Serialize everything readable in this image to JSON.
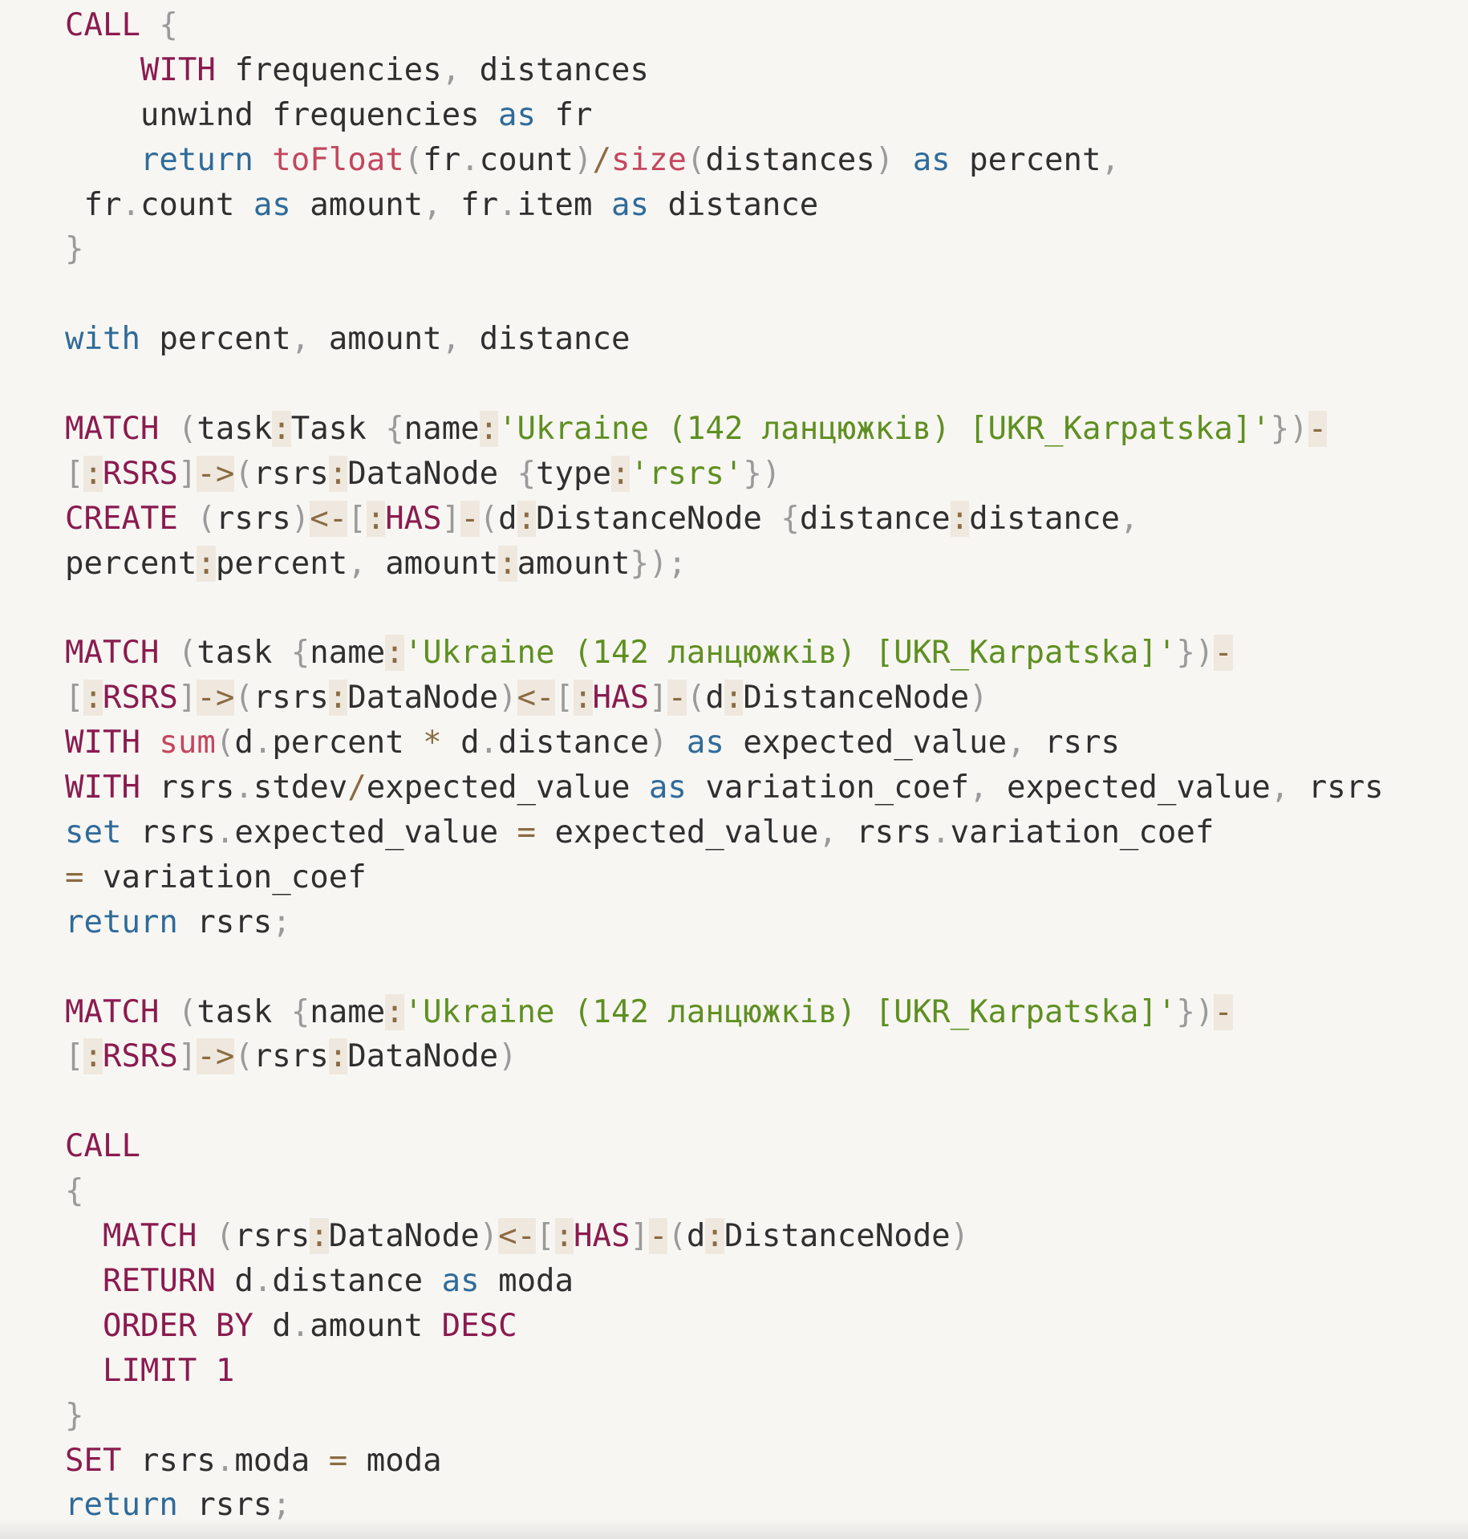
{
  "code_lines": [
    [
      {
        "text": "CALL",
        "type": "kw"
      },
      {
        "text": " ",
        "type": "plain"
      },
      {
        "text": "{",
        "type": "punc"
      }
    ],
    [
      {
        "text": "    ",
        "type": "plain"
      },
      {
        "text": "WITH",
        "type": "kw"
      },
      {
        "text": " frequencies",
        "type": "plain"
      },
      {
        "text": ",",
        "type": "punc"
      },
      {
        "text": " distances",
        "type": "plain"
      }
    ],
    [
      {
        "text": "    unwind frequencies ",
        "type": "plain"
      },
      {
        "text": "as",
        "type": "ret"
      },
      {
        "text": " fr",
        "type": "plain"
      }
    ],
    [
      {
        "text": "    ",
        "type": "plain"
      },
      {
        "text": "return",
        "type": "ret"
      },
      {
        "text": " ",
        "type": "plain"
      },
      {
        "text": "toFloat",
        "type": "fn"
      },
      {
        "text": "(",
        "type": "punc"
      },
      {
        "text": "fr",
        "type": "plain"
      },
      {
        "text": ".",
        "type": "punc"
      },
      {
        "text": "count",
        "type": "plain"
      },
      {
        "text": ")",
        "type": "punc"
      },
      {
        "text": "/",
        "type": "op"
      },
      {
        "text": "size",
        "type": "fn"
      },
      {
        "text": "(",
        "type": "punc"
      },
      {
        "text": "distances",
        "type": "plain"
      },
      {
        "text": ")",
        "type": "punc"
      },
      {
        "text": " ",
        "type": "plain"
      },
      {
        "text": "as",
        "type": "ret"
      },
      {
        "text": " percent",
        "type": "plain"
      },
      {
        "text": ",",
        "type": "punc"
      }
    ],
    [
      {
        "text": " fr",
        "type": "plain"
      },
      {
        "text": ".",
        "type": "punc"
      },
      {
        "text": "count ",
        "type": "plain"
      },
      {
        "text": "as",
        "type": "ret"
      },
      {
        "text": " amount",
        "type": "plain"
      },
      {
        "text": ",",
        "type": "punc"
      },
      {
        "text": " fr",
        "type": "plain"
      },
      {
        "text": ".",
        "type": "punc"
      },
      {
        "text": "item ",
        "type": "plain"
      },
      {
        "text": "as",
        "type": "ret"
      },
      {
        "text": " distance",
        "type": "plain"
      }
    ],
    [
      {
        "text": "}",
        "type": "punc"
      }
    ],
    [],
    [
      {
        "text": "with",
        "type": "ret"
      },
      {
        "text": " percent",
        "type": "plain"
      },
      {
        "text": ",",
        "type": "punc"
      },
      {
        "text": " amount",
        "type": "plain"
      },
      {
        "text": ",",
        "type": "punc"
      },
      {
        "text": " distance",
        "type": "plain"
      }
    ],
    [],
    [
      {
        "text": "MATCH",
        "type": "kw"
      },
      {
        "text": " ",
        "type": "plain"
      },
      {
        "text": "(",
        "type": "punc"
      },
      {
        "text": "task",
        "type": "plain"
      },
      {
        "text": ":",
        "type": "op",
        "bg": true
      },
      {
        "text": "Task ",
        "type": "plain"
      },
      {
        "text": "{",
        "type": "punc"
      },
      {
        "text": "name",
        "type": "plain"
      },
      {
        "text": ":",
        "type": "op",
        "bg": true
      },
      {
        "text": "'Ukraine (142 ланцюжків) [UKR_Karpatska]'",
        "type": "str"
      },
      {
        "text": "}",
        "type": "punc"
      },
      {
        "text": ")",
        "type": "punc"
      },
      {
        "text": "-",
        "type": "op",
        "bg": true
      }
    ],
    [
      {
        "text": "[",
        "type": "punc"
      },
      {
        "text": ":",
        "type": "op",
        "bg": true
      },
      {
        "text": "RSRS",
        "type": "kw"
      },
      {
        "text": "]",
        "type": "punc"
      },
      {
        "text": "->",
        "type": "op",
        "bg": true
      },
      {
        "text": "(",
        "type": "punc"
      },
      {
        "text": "rsrs",
        "type": "plain"
      },
      {
        "text": ":",
        "type": "op",
        "bg": true
      },
      {
        "text": "DataNode ",
        "type": "plain"
      },
      {
        "text": "{",
        "type": "punc"
      },
      {
        "text": "type",
        "type": "plain"
      },
      {
        "text": ":",
        "type": "op",
        "bg": true
      },
      {
        "text": "'rsrs'",
        "type": "str"
      },
      {
        "text": "}",
        "type": "punc"
      },
      {
        "text": ")",
        "type": "punc"
      }
    ],
    [
      {
        "text": "CREATE",
        "type": "kw"
      },
      {
        "text": " ",
        "type": "plain"
      },
      {
        "text": "(",
        "type": "punc"
      },
      {
        "text": "rsrs",
        "type": "plain"
      },
      {
        "text": ")",
        "type": "punc"
      },
      {
        "text": "<-",
        "type": "op",
        "bg": true
      },
      {
        "text": "[",
        "type": "punc"
      },
      {
        "text": ":",
        "type": "op",
        "bg": true
      },
      {
        "text": "HAS",
        "type": "kw"
      },
      {
        "text": "]",
        "type": "punc"
      },
      {
        "text": "-",
        "type": "op",
        "bg": true
      },
      {
        "text": "(",
        "type": "punc"
      },
      {
        "text": "d",
        "type": "plain"
      },
      {
        "text": ":",
        "type": "op",
        "bg": true
      },
      {
        "text": "DistanceNode ",
        "type": "plain"
      },
      {
        "text": "{",
        "type": "punc"
      },
      {
        "text": "distance",
        "type": "plain"
      },
      {
        "text": ":",
        "type": "op",
        "bg": true
      },
      {
        "text": "distance",
        "type": "plain"
      },
      {
        "text": ",",
        "type": "punc"
      }
    ],
    [
      {
        "text": "percent",
        "type": "plain"
      },
      {
        "text": ":",
        "type": "op",
        "bg": true
      },
      {
        "text": "percent",
        "type": "plain"
      },
      {
        "text": ",",
        "type": "punc"
      },
      {
        "text": " amount",
        "type": "plain"
      },
      {
        "text": ":",
        "type": "op",
        "bg": true
      },
      {
        "text": "amount",
        "type": "plain"
      },
      {
        "text": "}",
        "type": "punc"
      },
      {
        "text": ")",
        "type": "punc"
      },
      {
        "text": ";",
        "type": "punc"
      }
    ],
    [],
    [
      {
        "text": "MATCH",
        "type": "kw"
      },
      {
        "text": " ",
        "type": "plain"
      },
      {
        "text": "(",
        "type": "punc"
      },
      {
        "text": "task ",
        "type": "plain"
      },
      {
        "text": "{",
        "type": "punc"
      },
      {
        "text": "name",
        "type": "plain"
      },
      {
        "text": ":",
        "type": "op",
        "bg": true
      },
      {
        "text": "'Ukraine (142 ланцюжків) [UKR_Karpatska]'",
        "type": "str"
      },
      {
        "text": "}",
        "type": "punc"
      },
      {
        "text": ")",
        "type": "punc"
      },
      {
        "text": "-",
        "type": "op",
        "bg": true
      }
    ],
    [
      {
        "text": "[",
        "type": "punc"
      },
      {
        "text": ":",
        "type": "op",
        "bg": true
      },
      {
        "text": "RSRS",
        "type": "kw"
      },
      {
        "text": "]",
        "type": "punc"
      },
      {
        "text": "->",
        "type": "op",
        "bg": true
      },
      {
        "text": "(",
        "type": "punc"
      },
      {
        "text": "rsrs",
        "type": "plain"
      },
      {
        "text": ":",
        "type": "op",
        "bg": true
      },
      {
        "text": "DataNode",
        "type": "plain"
      },
      {
        "text": ")",
        "type": "punc"
      },
      {
        "text": "<-",
        "type": "op",
        "bg": true
      },
      {
        "text": "[",
        "type": "punc"
      },
      {
        "text": ":",
        "type": "op",
        "bg": true
      },
      {
        "text": "HAS",
        "type": "kw"
      },
      {
        "text": "]",
        "type": "punc"
      },
      {
        "text": "-",
        "type": "op",
        "bg": true
      },
      {
        "text": "(",
        "type": "punc"
      },
      {
        "text": "d",
        "type": "plain"
      },
      {
        "text": ":",
        "type": "op",
        "bg": true
      },
      {
        "text": "DistanceNode",
        "type": "plain"
      },
      {
        "text": ")",
        "type": "punc"
      }
    ],
    [
      {
        "text": "WITH",
        "type": "kw"
      },
      {
        "text": " ",
        "type": "plain"
      },
      {
        "text": "sum",
        "type": "fn"
      },
      {
        "text": "(",
        "type": "punc"
      },
      {
        "text": "d",
        "type": "plain"
      },
      {
        "text": ".",
        "type": "punc"
      },
      {
        "text": "percent ",
        "type": "plain"
      },
      {
        "text": "*",
        "type": "op"
      },
      {
        "text": " d",
        "type": "plain"
      },
      {
        "text": ".",
        "type": "punc"
      },
      {
        "text": "distance",
        "type": "plain"
      },
      {
        "text": ")",
        "type": "punc"
      },
      {
        "text": " ",
        "type": "plain"
      },
      {
        "text": "as",
        "type": "ret"
      },
      {
        "text": " expected_value",
        "type": "plain"
      },
      {
        "text": ",",
        "type": "punc"
      },
      {
        "text": " rsrs",
        "type": "plain"
      }
    ],
    [
      {
        "text": "WITH",
        "type": "kw"
      },
      {
        "text": " rsrs",
        "type": "plain"
      },
      {
        "text": ".",
        "type": "punc"
      },
      {
        "text": "stdev",
        "type": "plain"
      },
      {
        "text": "/",
        "type": "op"
      },
      {
        "text": "expected_value ",
        "type": "plain"
      },
      {
        "text": "as",
        "type": "ret"
      },
      {
        "text": " variation_coef",
        "type": "plain"
      },
      {
        "text": ",",
        "type": "punc"
      },
      {
        "text": " expected_value",
        "type": "plain"
      },
      {
        "text": ",",
        "type": "punc"
      },
      {
        "text": " rsrs",
        "type": "plain"
      }
    ],
    [
      {
        "text": "set",
        "type": "ret"
      },
      {
        "text": " rsrs",
        "type": "plain"
      },
      {
        "text": ".",
        "type": "punc"
      },
      {
        "text": "expected_value ",
        "type": "plain"
      },
      {
        "text": "=",
        "type": "op"
      },
      {
        "text": " expected_value",
        "type": "plain"
      },
      {
        "text": ",",
        "type": "punc"
      },
      {
        "text": " rsrs",
        "type": "plain"
      },
      {
        "text": ".",
        "type": "punc"
      },
      {
        "text": "variation_coef",
        "type": "plain"
      }
    ],
    [
      {
        "text": "=",
        "type": "op"
      },
      {
        "text": " variation_coef",
        "type": "plain"
      }
    ],
    [
      {
        "text": "return",
        "type": "ret"
      },
      {
        "text": " rsrs",
        "type": "plain"
      },
      {
        "text": ";",
        "type": "punc"
      }
    ],
    [],
    [
      {
        "text": "MATCH",
        "type": "kw"
      },
      {
        "text": " ",
        "type": "plain"
      },
      {
        "text": "(",
        "type": "punc"
      },
      {
        "text": "task ",
        "type": "plain"
      },
      {
        "text": "{",
        "type": "punc"
      },
      {
        "text": "name",
        "type": "plain"
      },
      {
        "text": ":",
        "type": "op",
        "bg": true
      },
      {
        "text": "'Ukraine (142 ланцюжків) [UKR_Karpatska]'",
        "type": "str"
      },
      {
        "text": "}",
        "type": "punc"
      },
      {
        "text": ")",
        "type": "punc"
      },
      {
        "text": "-",
        "type": "op",
        "bg": true
      }
    ],
    [
      {
        "text": "[",
        "type": "punc"
      },
      {
        "text": ":",
        "type": "op",
        "bg": true
      },
      {
        "text": "RSRS",
        "type": "kw"
      },
      {
        "text": "]",
        "type": "punc"
      },
      {
        "text": "->",
        "type": "op",
        "bg": true
      },
      {
        "text": "(",
        "type": "punc"
      },
      {
        "text": "rsrs",
        "type": "plain"
      },
      {
        "text": ":",
        "type": "op",
        "bg": true
      },
      {
        "text": "DataNode",
        "type": "plain"
      },
      {
        "text": ")",
        "type": "punc"
      }
    ],
    [],
    [
      {
        "text": "CALL",
        "type": "kw"
      }
    ],
    [
      {
        "text": "{",
        "type": "punc"
      }
    ],
    [
      {
        "text": "  ",
        "type": "plain"
      },
      {
        "text": "MATCH",
        "type": "kw"
      },
      {
        "text": " ",
        "type": "plain"
      },
      {
        "text": "(",
        "type": "punc"
      },
      {
        "text": "rsrs",
        "type": "plain"
      },
      {
        "text": ":",
        "type": "op",
        "bg": true
      },
      {
        "text": "DataNode",
        "type": "plain"
      },
      {
        "text": ")",
        "type": "punc"
      },
      {
        "text": "<-",
        "type": "op",
        "bg": true
      },
      {
        "text": "[",
        "type": "punc"
      },
      {
        "text": ":",
        "type": "op",
        "bg": true
      },
      {
        "text": "HAS",
        "type": "kw"
      },
      {
        "text": "]",
        "type": "punc"
      },
      {
        "text": "-",
        "type": "op",
        "bg": true
      },
      {
        "text": "(",
        "type": "punc"
      },
      {
        "text": "d",
        "type": "plain"
      },
      {
        "text": ":",
        "type": "op",
        "bg": true
      },
      {
        "text": "DistanceNode",
        "type": "plain"
      },
      {
        "text": ")",
        "type": "punc"
      }
    ],
    [
      {
        "text": "  ",
        "type": "plain"
      },
      {
        "text": "RETURN",
        "type": "kw"
      },
      {
        "text": " d",
        "type": "plain"
      },
      {
        "text": ".",
        "type": "punc"
      },
      {
        "text": "distance ",
        "type": "plain"
      },
      {
        "text": "as",
        "type": "ret"
      },
      {
        "text": " moda",
        "type": "plain"
      }
    ],
    [
      {
        "text": "  ",
        "type": "plain"
      },
      {
        "text": "ORDER BY",
        "type": "kw"
      },
      {
        "text": " d",
        "type": "plain"
      },
      {
        "text": ".",
        "type": "punc"
      },
      {
        "text": "amount ",
        "type": "plain"
      },
      {
        "text": "DESC",
        "type": "kw"
      }
    ],
    [
      {
        "text": "  ",
        "type": "plain"
      },
      {
        "text": "LIMIT 1",
        "type": "kw"
      }
    ],
    [
      {
        "text": "}",
        "type": "punc"
      }
    ],
    [
      {
        "text": "SET",
        "type": "kw"
      },
      {
        "text": " rsrs",
        "type": "plain"
      },
      {
        "text": ".",
        "type": "punc"
      },
      {
        "text": "moda ",
        "type": "plain"
      },
      {
        "text": "=",
        "type": "op"
      },
      {
        "text": " moda",
        "type": "plain"
      }
    ],
    [
      {
        "text": "return",
        "type": "ret"
      },
      {
        "text": " rsrs",
        "type": "plain"
      },
      {
        "text": ";",
        "type": "punc"
      }
    ]
  ]
}
